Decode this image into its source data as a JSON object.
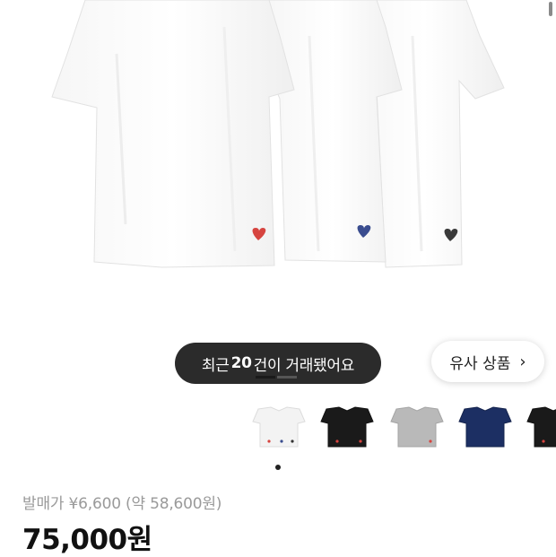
{
  "product": {
    "recent_trade_prefix": "최근 ",
    "recent_trade_count": "20",
    "recent_trade_suffix": "건이 거래됐어요",
    "similar_products_label": "유사 상품",
    "release_price_label": "발매가 ¥6,600 (약 58,600원)",
    "price": "75,000원"
  },
  "gallery": {
    "thumbnails": [
      {
        "name": "white",
        "color": "#f3f3f3"
      },
      {
        "name": "black",
        "color": "#1a1a1a"
      },
      {
        "name": "gray",
        "color": "#b9b9b9"
      },
      {
        "name": "navy",
        "color": "#1c2f63"
      },
      {
        "name": "black-partial",
        "color": "#1a1a1a"
      }
    ],
    "heart_colors": [
      "#d6443f",
      "#3a4d8f",
      "#3a3a3a"
    ]
  },
  "icons": {
    "chevron": "chevron-right-icon"
  }
}
